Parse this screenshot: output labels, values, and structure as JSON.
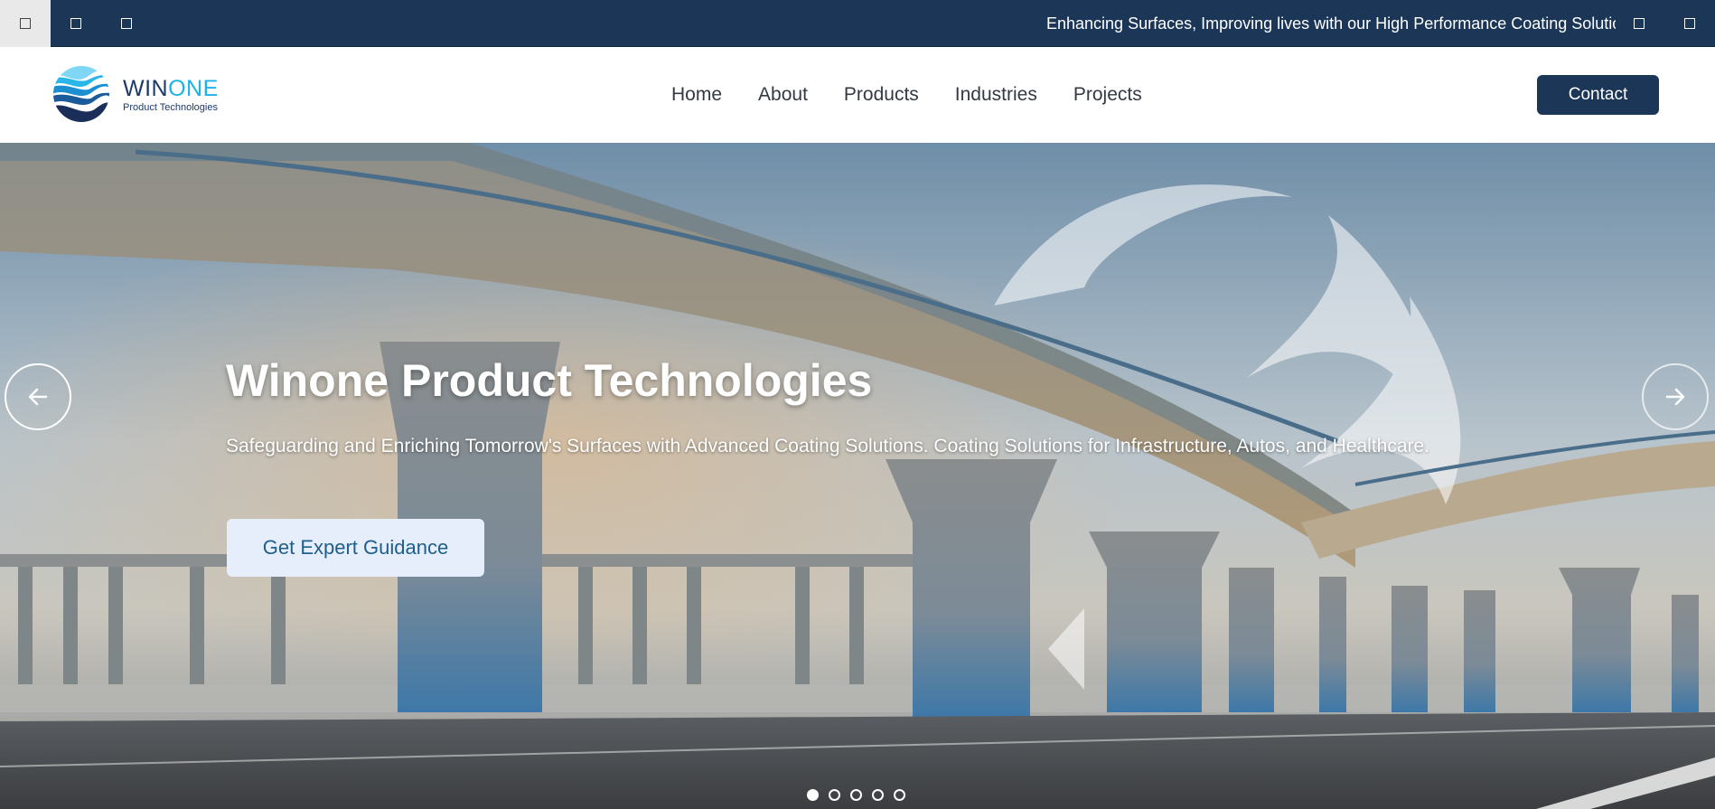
{
  "topbar": {
    "marquee_text": "Enhancing Surfaces, Improving lives with our High Performance Coating Solutions"
  },
  "brand": {
    "name_part1": "WIN",
    "name_part2": "ONE",
    "tagline": "Product Technologies",
    "colors": {
      "primary": "#1b3657",
      "accent": "#1bb3e8"
    }
  },
  "nav": {
    "items": [
      {
        "label": "Home"
      },
      {
        "label": "About"
      },
      {
        "label": "Products"
      },
      {
        "label": "Industries"
      },
      {
        "label": "Projects"
      }
    ],
    "contact_label": "Contact"
  },
  "hero": {
    "title": "Winone Product Technologies",
    "subtitle": "Safeguarding and Enriching Tomorrow's Surfaces with Advanced Coating Solutions. Coating Solutions for Infrastructure, Autos, and Healthcare.",
    "cta_label": "Get Expert Guidance",
    "prev_icon": "arrow-left-icon",
    "next_icon": "arrow-right-icon",
    "slide_count": 5,
    "active_slide": 1
  }
}
